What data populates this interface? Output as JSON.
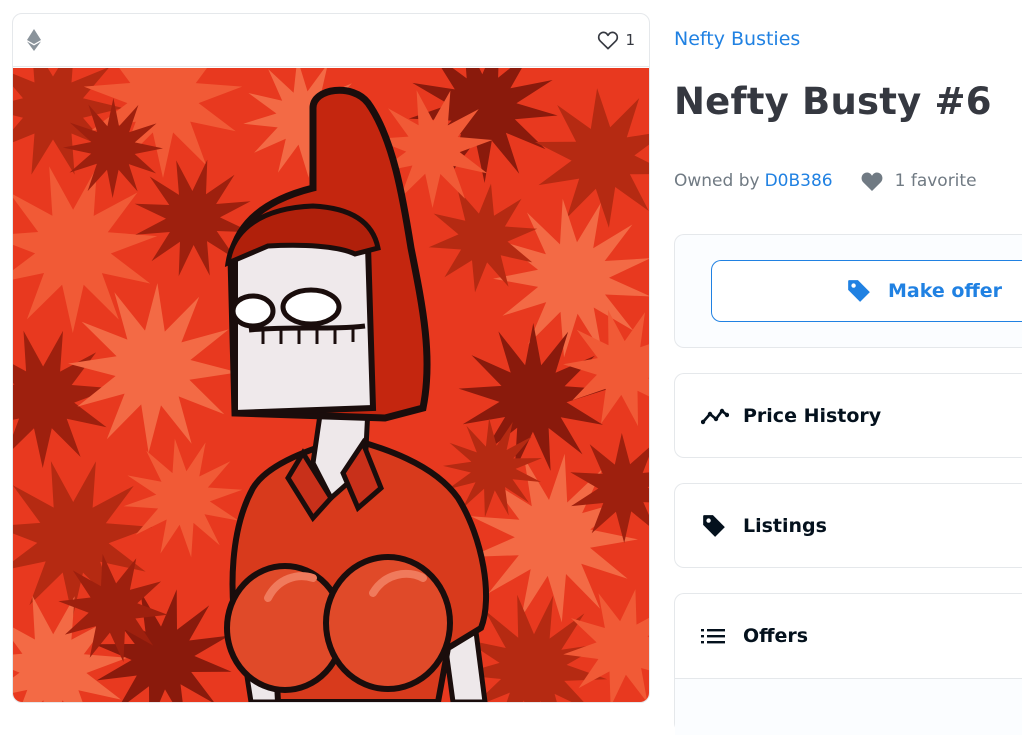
{
  "item_card": {
    "chain_icon": "ethereum-icon",
    "favorite_icon": "heart-outline-icon",
    "favorite_count": "1",
    "image_description_icon": "nft-artwork"
  },
  "details": {
    "collection_name": "Nefty Busties",
    "item_title": "Nefty Busty #6",
    "owned_by_label": "Owned by",
    "owner_name": "D0B386",
    "favorites_label": "1 favorite"
  },
  "actions": {
    "make_offer_label": "Make offer"
  },
  "sections": {
    "price_history": "Price History",
    "listings": "Listings",
    "offers": "Offers"
  },
  "colors": {
    "accent": "#2081e2",
    "text": "#353840",
    "muted": "#707a83",
    "art_bg": "#e8391f"
  }
}
